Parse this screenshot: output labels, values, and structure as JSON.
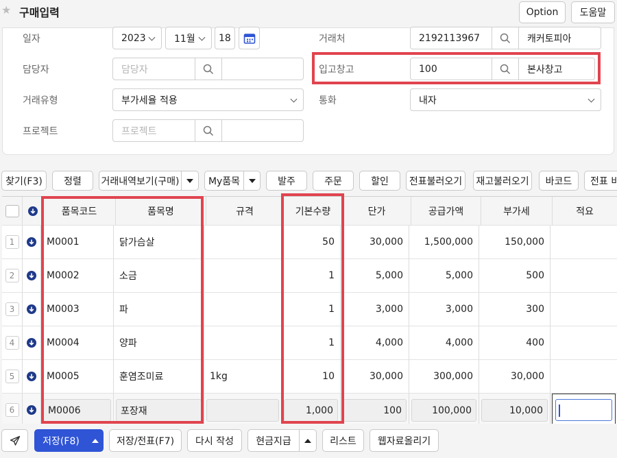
{
  "header": {
    "title": "구매입력",
    "option_label": "Option",
    "help_label": "도움말"
  },
  "form": {
    "date_label": "일자",
    "year": "2023",
    "month": "11월",
    "day": "18",
    "manager_label": "담당자",
    "manager_placeholder": "담당자",
    "trade_type_label": "거래유형",
    "trade_type_value": "부가세율 적용",
    "project_label": "프로젝트",
    "project_placeholder": "프로젝트",
    "client_label": "거래처",
    "client_code": "2192113967",
    "client_name": "캐커토피아",
    "warehouse_label": "입고창고",
    "warehouse_code": "100",
    "warehouse_name": "본사창고",
    "currency_label": "통화",
    "currency_value": "내자"
  },
  "toolbar": {
    "find": "찾기(F3)",
    "sort": "정렬",
    "history": "거래내역보기(구매)",
    "my_items": "My품목",
    "order": "발주",
    "order2": "주문",
    "discount": "할인",
    "load_slip": "전표불러오기",
    "load_stock": "재고불러오기",
    "barcode": "바코드",
    "slip_more": "전표 비"
  },
  "grid": {
    "headers": {
      "code": "품목코드",
      "name": "품목명",
      "spec": "규격",
      "qty": "기본수량",
      "price": "단가",
      "supply": "공급가액",
      "vat": "부가세",
      "memo": "적요"
    },
    "rows": [
      {
        "num": "1",
        "code": "M0001",
        "name": "닭가슴살",
        "spec": "",
        "qty": "50",
        "price": "30,000",
        "supply": "1,500,000",
        "vat": "150,000"
      },
      {
        "num": "2",
        "code": "M0002",
        "name": "소금",
        "spec": "",
        "qty": "1",
        "price": "5,000",
        "supply": "5,000",
        "vat": "500"
      },
      {
        "num": "3",
        "code": "M0003",
        "name": "파",
        "spec": "",
        "qty": "1",
        "price": "3,000",
        "supply": "3,000",
        "vat": "300"
      },
      {
        "num": "4",
        "code": "M0004",
        "name": "양파",
        "spec": "",
        "qty": "1",
        "price": "4,000",
        "supply": "4,000",
        "vat": "400"
      },
      {
        "num": "5",
        "code": "M0005",
        "name": "훈염조미료",
        "spec": "1kg",
        "qty": "10",
        "price": "30,000",
        "supply": "300,000",
        "vat": "30,000"
      },
      {
        "num": "6",
        "code": "M0006",
        "name": "포장재",
        "spec": "",
        "qty": "1,000",
        "price": "100",
        "supply": "100,000",
        "vat": "10,000"
      }
    ]
  },
  "footer": {
    "save": "저장(F8)",
    "save_slip": "저장/전표(F7)",
    "rewrite": "다시 작성",
    "cash": "현금지급",
    "list": "리스트",
    "upload": "웹자료올리기"
  },
  "colors": {
    "primary": "#2f54d6",
    "highlight": "#e0444f",
    "download_icon": "#1f3a8a"
  }
}
